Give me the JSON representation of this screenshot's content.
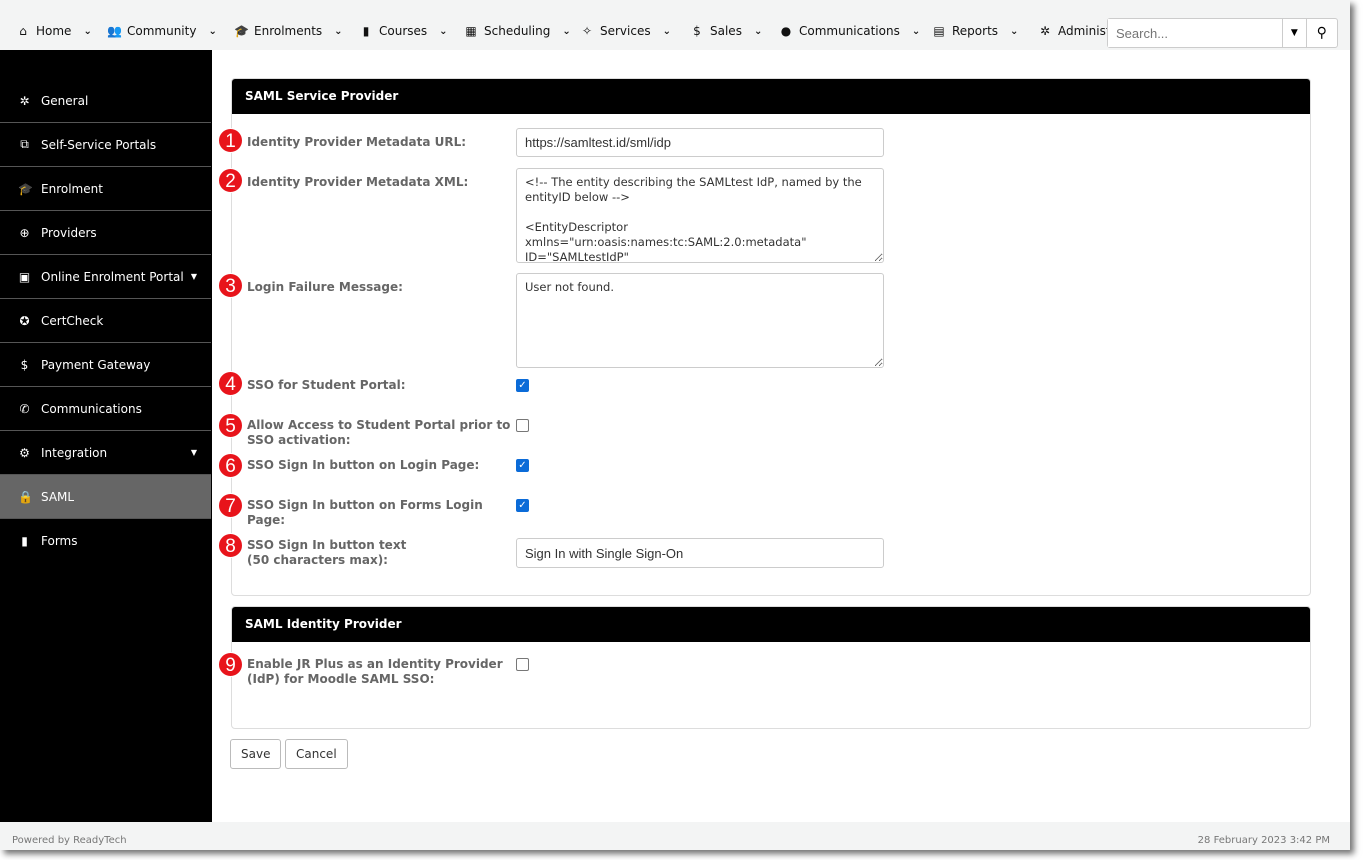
{
  "nav": [
    {
      "label": "Home",
      "icon": "home-icon",
      "glyph": "⌂"
    },
    {
      "label": "Community",
      "icon": "users-icon",
      "glyph": "👥"
    },
    {
      "label": "Enrolments",
      "icon": "graduation-cap-icon",
      "glyph": "🎓"
    },
    {
      "label": "Courses",
      "icon": "book-icon",
      "glyph": "▮"
    },
    {
      "label": "Scheduling",
      "icon": "calendar-icon",
      "glyph": "▦"
    },
    {
      "label": "Services",
      "icon": "handshake-icon",
      "glyph": "✧"
    },
    {
      "label": "Sales",
      "icon": "dollar-icon",
      "glyph": "$"
    },
    {
      "label": "Communications",
      "icon": "comment-icon",
      "glyph": "●"
    },
    {
      "label": "Reports",
      "icon": "report-icon",
      "glyph": "▤"
    },
    {
      "label": "Administ",
      "icon": "gear-icon",
      "glyph": "✲"
    }
  ],
  "search": {
    "placeholder": "Search..."
  },
  "sidebar": [
    {
      "label": "General",
      "glyph": "✲",
      "icon": "gear-icon"
    },
    {
      "label": "Self-Service Portals",
      "glyph": "⧉",
      "icon": "copy-icon"
    },
    {
      "label": "Enrolment",
      "glyph": "🎓",
      "icon": "graduation-cap-icon"
    },
    {
      "label": "Providers",
      "glyph": "⊕",
      "icon": "globe-icon"
    },
    {
      "label": "Online Enrolment Portal",
      "glyph": "▣",
      "icon": "portal-icon",
      "caret": true
    },
    {
      "label": "CertCheck",
      "glyph": "✪",
      "icon": "award-icon"
    },
    {
      "label": "Payment Gateway",
      "glyph": "$",
      "icon": "dollar-icon"
    },
    {
      "label": "Communications",
      "glyph": "✆",
      "icon": "phone-icon"
    },
    {
      "label": "Integration",
      "glyph": "⚙",
      "icon": "cogs-icon",
      "caret": true
    },
    {
      "label": "SAML",
      "glyph": "🔒",
      "icon": "lock-icon",
      "active": true
    },
    {
      "label": "Forms",
      "glyph": "▮",
      "icon": "forms-icon"
    }
  ],
  "sp": {
    "title": "SAML Service Provider",
    "url_label": "Identity Provider Metadata URL:",
    "url_value": "https://samltest.id/sml/idp",
    "xml_label": "Identity Provider Metadata XML:",
    "xml_value": "<!-- The entity describing the SAMLtest IdP, named by the entityID below -->\n\n<EntityDescriptor xmlns=\"urn:oasis:names:tc:SAML:2.0:metadata\" ID=\"SAMLtestIdP\"",
    "fail_label": "Login Failure Message:",
    "fail_value": "User not found.",
    "sso_student_label": "SSO for Student Portal:",
    "sso_student": true,
    "allow_access_label": "Allow Access to Student Portal prior to SSO activation:",
    "allow_access": false,
    "sso_login_label": "SSO Sign In button on Login Page:",
    "sso_login": true,
    "sso_forms_label": "SSO Sign In button on Forms Login Page:",
    "sso_forms": true,
    "btn_text_label": "SSO Sign In button text",
    "btn_text_sub": "(50 characters max):",
    "btn_text_value": "Sign In with Single Sign-On"
  },
  "idp": {
    "title": "SAML Identity Provider",
    "enable_label": "Enable JR Plus as an Identity Provider (IdP) for Moodle SAML SSO:",
    "enable": false
  },
  "buttons": {
    "save": "Save",
    "cancel": "Cancel"
  },
  "badges": [
    "1",
    "2",
    "3",
    "4",
    "5",
    "6",
    "7",
    "8",
    "9"
  ],
  "footer": {
    "left": "Powered by ReadyTech",
    "right": "28 February 2023 3:42 PM"
  },
  "colors": {
    "badge": "#e8141b",
    "checkbox": "#0b6bd8",
    "active_side": "#666666"
  }
}
